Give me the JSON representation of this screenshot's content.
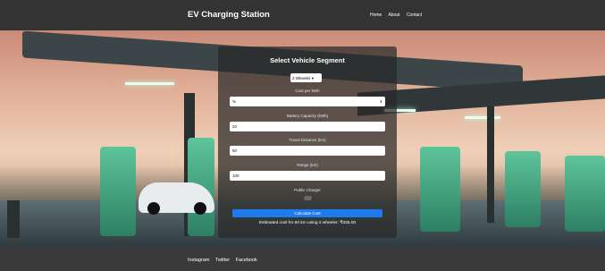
{
  "header": {
    "brand": "EV Charging Station",
    "nav": [
      "Home",
      "About",
      "Contact"
    ]
  },
  "form": {
    "title": "Select Vehicle Segment",
    "vehicle_segment": {
      "selected": "2 Wheeler"
    },
    "fields": [
      {
        "label": "Cost per kWh",
        "value": "%"
      },
      {
        "label": "Battery Capacity (kWh)",
        "value": "20"
      },
      {
        "label": "Travel Distance (km)",
        "value": "50"
      },
      {
        "label": "Range (km)",
        "value": "100"
      }
    ],
    "public_charger_label": "Public Charger",
    "calculate_label": "Calculate Cost",
    "result": "Estimated cost for 50 km using 2 wheeler: ₹335.00"
  },
  "footer": {
    "links": [
      "Instagram",
      "Twitter",
      "Facebook"
    ]
  },
  "colors": {
    "header_bg": "#333333",
    "button": "#1e7bef"
  },
  "icons": {
    "dropdown": "chevron-down-icon",
    "stepper": "spinner-arrows-icon",
    "toggle": "toggle-switch"
  }
}
